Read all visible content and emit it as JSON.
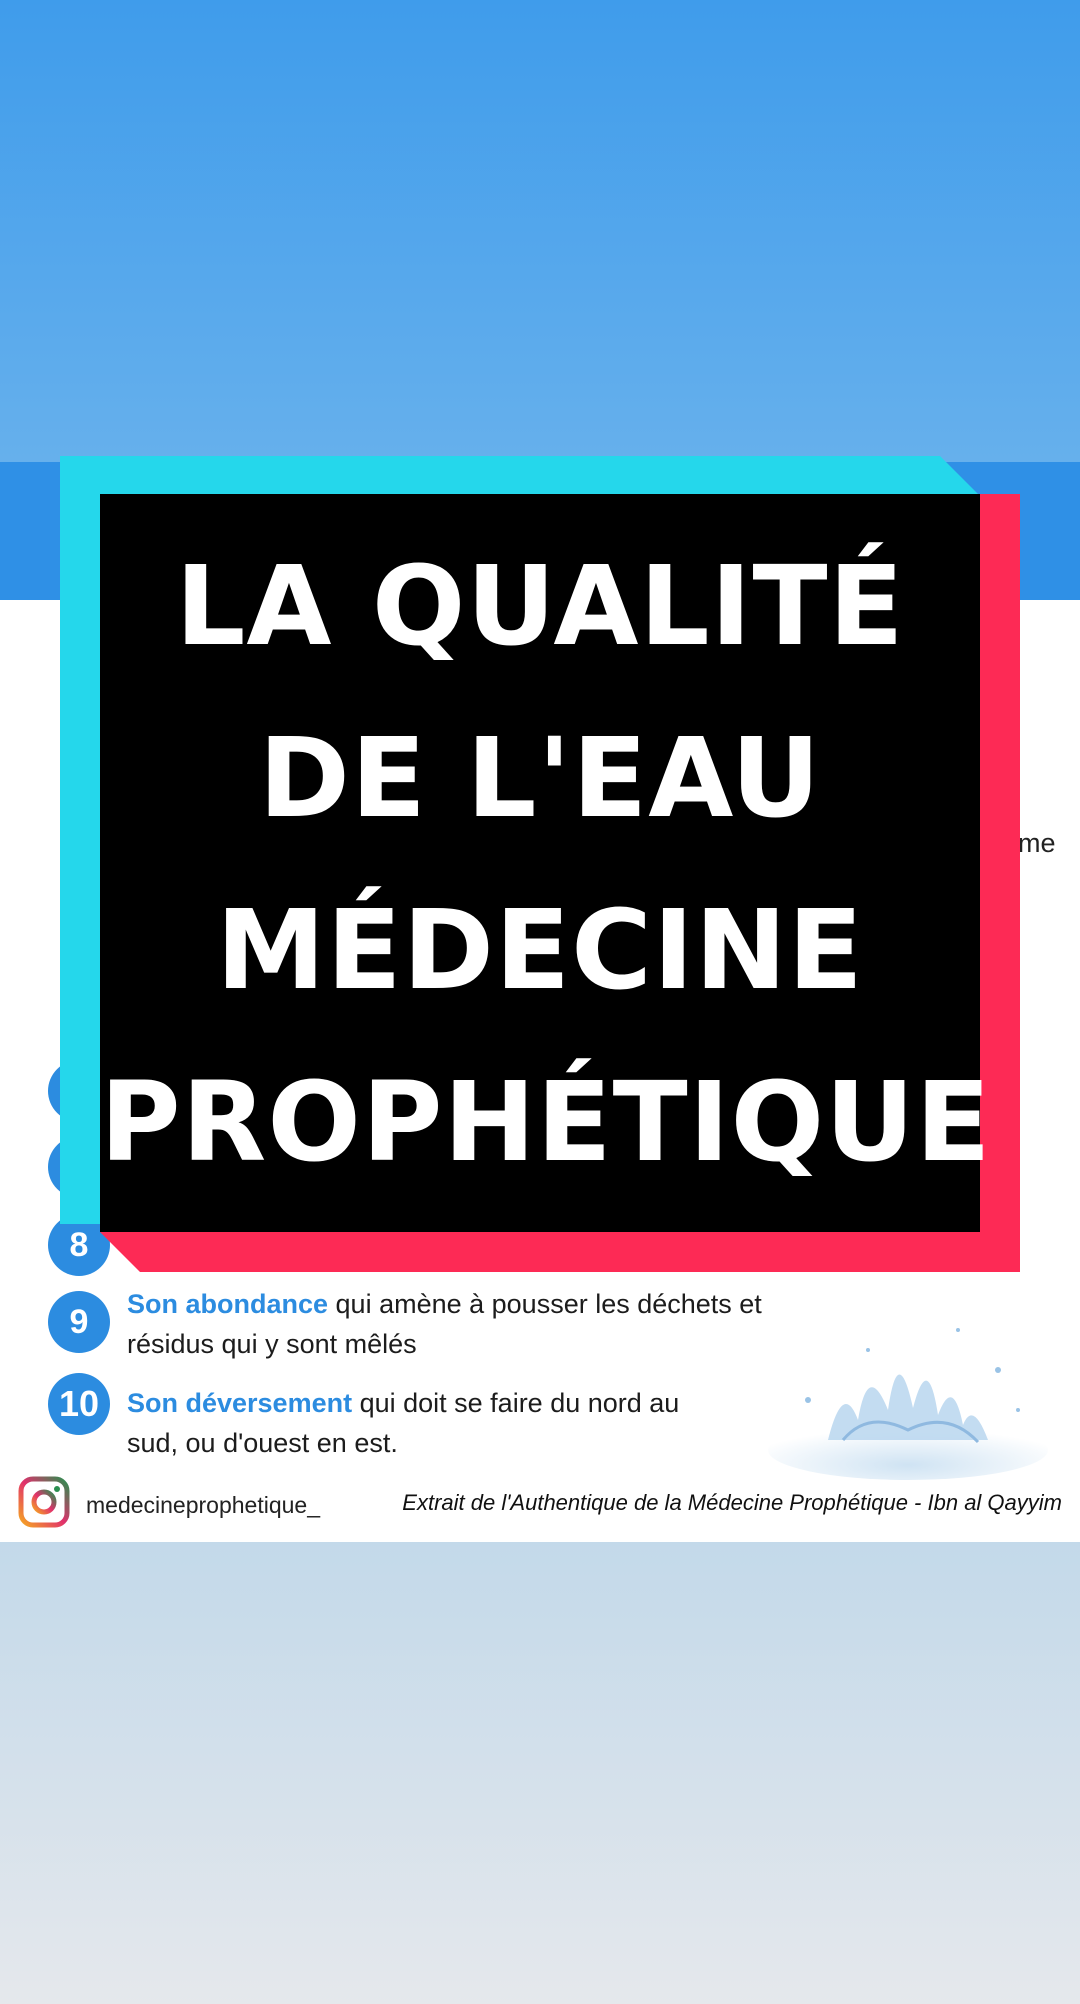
{
  "title": {
    "lines": [
      "LA QUALITÉ",
      "DE L'EAU",
      "MÉDECINE",
      "PROPHÉTIQUE"
    ]
  },
  "background_text": {
    "partial": "me"
  },
  "items": [
    {
      "number": "8",
      "highlight": "",
      "text_line1": "",
      "text_line2": ""
    },
    {
      "number": "9",
      "highlight": "Son abondance",
      "text_line1": " qui amène à pousser les déchets et",
      "text_line2": "résidus qui y sont mêlés"
    },
    {
      "number": "10",
      "highlight": "Son déversement",
      "text_line1": " qui doit se faire du nord au",
      "text_line2": "sud, ou d'ouest en est."
    }
  ],
  "footer": {
    "instagram_icon": "instagram-icon",
    "handle": "medecineprophetique_",
    "source": "Extrait de l'Authentique de la Médecine Prophétique - Ibn al Qayyim"
  },
  "colors": {
    "accent_blue": "#2c8ce0",
    "cyan": "#25d7eb",
    "red": "#fd2a55",
    "black": "#000000"
  }
}
